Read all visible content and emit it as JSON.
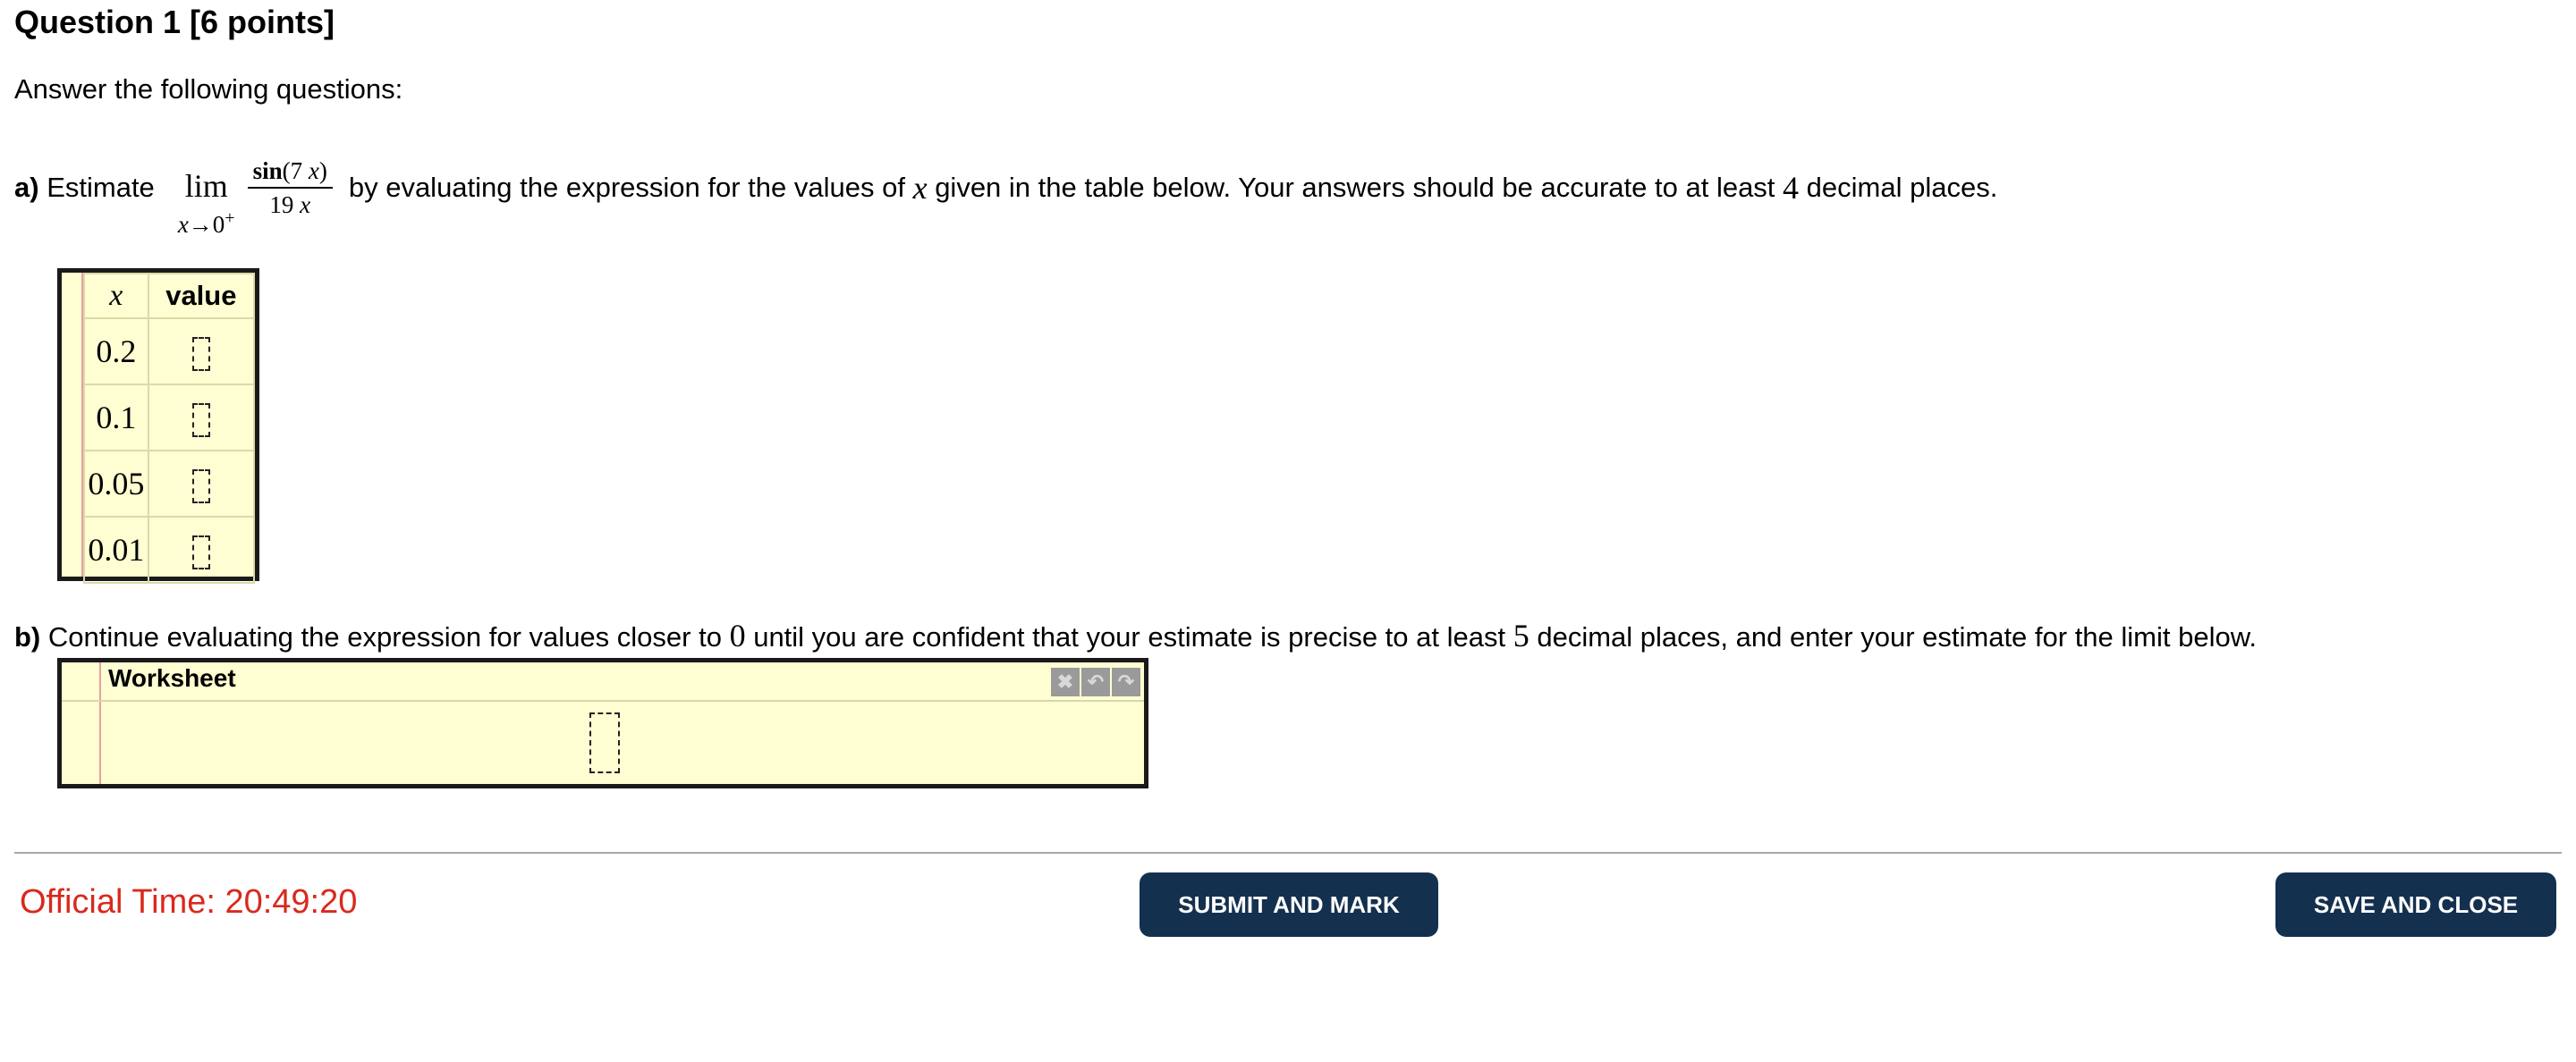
{
  "question": {
    "title": "Question 1 [6 points]",
    "instructions": "Answer the following questions:"
  },
  "part_a": {
    "label": "a)",
    "text_before": "Estimate",
    "limit_word": "lim",
    "limit_var": "x",
    "limit_arrow": "→",
    "limit_target": "0",
    "limit_sup": "+",
    "frac_func": "sin",
    "frac_arg_open": "(7 ",
    "frac_arg_var": "x",
    "frac_arg_close": ")",
    "frac_den_num": "19 ",
    "frac_den_var": "x",
    "text_mid1": "by evaluating the expression for the values of",
    "var_x": "x",
    "text_mid2": "given in the table below. Your answers should be accurate to at least",
    "decimals": "4",
    "text_end": "decimal places."
  },
  "table": {
    "header_x": "x",
    "header_value": "value",
    "rows": [
      {
        "x": "0.2",
        "value": ""
      },
      {
        "x": "0.1",
        "value": ""
      },
      {
        "x": "0.05",
        "value": ""
      },
      {
        "x": "0.01",
        "value": ""
      }
    ]
  },
  "part_b": {
    "label": "b)",
    "text1": "Continue evaluating the expression for values closer to",
    "zero": "0",
    "text2": "until you are confident that your estimate is precise to at least",
    "decimals": "5",
    "text3": "decimal places, and enter your estimate for the limit below."
  },
  "worksheet": {
    "title": "Worksheet",
    "tools": [
      {
        "icon": "delete-icon",
        "glyph": "✖"
      },
      {
        "icon": "undo-icon",
        "glyph": "↶"
      },
      {
        "icon": "redo-icon",
        "glyph": "↷"
      }
    ]
  },
  "footer": {
    "official_time_label": "Official Time: 20:49:20",
    "submit_label": "SUBMIT AND MARK",
    "save_label": "SAVE AND CLOSE"
  },
  "colors": {
    "cell_background": "#fefed2",
    "button_background": "#14304f",
    "time_text": "#d9291c"
  }
}
